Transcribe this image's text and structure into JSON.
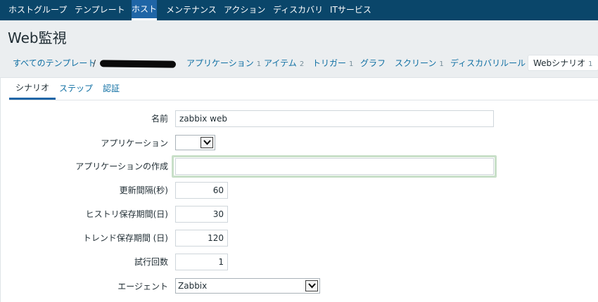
{
  "topnav": {
    "items": [
      "ホストグループ",
      "テンプレート",
      "ホスト",
      "メンテナンス",
      "アクション",
      "ディスカバリ",
      "ITサービス"
    ]
  },
  "page": {
    "title": "Web監視"
  },
  "breadcrumbs": {
    "all_templates": "すべてのテンプレート",
    "separator": "/",
    "items": [
      {
        "label": "アプリケーション",
        "count": "1"
      },
      {
        "label": "アイテム",
        "count": "2"
      },
      {
        "label": "トリガー",
        "count": "1"
      },
      {
        "label": "グラフ",
        "count": ""
      },
      {
        "label": "スクリーン",
        "count": "1"
      },
      {
        "label": "ディスカバリルール",
        "count": ""
      },
      {
        "label": "Webシナリオ",
        "count": "1"
      }
    ]
  },
  "tabs": [
    "シナリオ",
    "ステップ",
    "認証"
  ],
  "form": {
    "name": {
      "label": "名前",
      "value": "zabbix web"
    },
    "application": {
      "label": "アプリケーション",
      "value": ""
    },
    "new_application": {
      "label": "アプリケーションの作成",
      "value": ""
    },
    "update_interval": {
      "label": "更新間隔(秒)",
      "value": "60"
    },
    "history": {
      "label": "ヒストリ保存期間(日)",
      "value": "30"
    },
    "trends": {
      "label": "トレンド保存期間 (日)",
      "value": "120"
    },
    "attempts": {
      "label": "試行回数",
      "value": "1"
    },
    "agent": {
      "label": "エージェント",
      "value": "Zabbix"
    }
  }
}
